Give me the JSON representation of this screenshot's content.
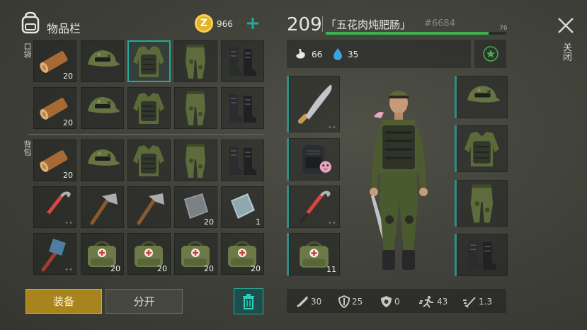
{
  "inventory": {
    "title": "物品栏",
    "coins": "966",
    "pocket_label": "口袋",
    "backpack_label": "背包",
    "pocket_rows": [
      [
        {
          "icon": "log-icon",
          "count": "20"
        },
        {
          "icon": "camo-cap-icon",
          "count": ""
        },
        {
          "icon": "camo-vest-icon",
          "count": "",
          "selected": true
        },
        {
          "icon": "camo-pants-icon",
          "count": ""
        },
        {
          "icon": "boots-icon",
          "count": ""
        }
      ],
      [
        {
          "icon": "log-icon",
          "count": "20"
        },
        {
          "icon": "camo-cap-icon",
          "count": ""
        },
        {
          "icon": "camo-vest-icon",
          "count": ""
        },
        {
          "icon": "camo-pants-icon",
          "count": ""
        },
        {
          "icon": "boots-icon",
          "count": ""
        }
      ]
    ],
    "backpack_rows": [
      [
        {
          "icon": "log-icon",
          "count": "20"
        },
        {
          "icon": "camo-cap-icon",
          "count": ""
        },
        {
          "icon": "camo-vest-icon",
          "count": ""
        },
        {
          "icon": "camo-pants-icon",
          "count": ""
        },
        {
          "icon": "boots-icon",
          "count": ""
        }
      ],
      [
        {
          "icon": "crowbar-icon",
          "count": "",
          "dots": true
        },
        {
          "icon": "hatchet-icon",
          "count": ""
        },
        {
          "icon": "hatchet-icon",
          "count": ""
        },
        {
          "icon": "metal-plate-icon",
          "count": "20"
        },
        {
          "icon": "metal-plate-blue-icon",
          "count": "1"
        }
      ],
      [
        {
          "icon": "sledgehammer-icon",
          "count": "",
          "dots": true
        },
        {
          "icon": "first-aid-bag-icon",
          "count": "20"
        },
        {
          "icon": "first-aid-bag-icon",
          "count": "20"
        },
        {
          "icon": "first-aid-bag-icon",
          "count": "20"
        },
        {
          "icon": "first-aid-bag-icon",
          "count": "20"
        }
      ]
    ],
    "equip_button": "装备",
    "split_button": "分开"
  },
  "player": {
    "level": "209",
    "name": "「五花肉炖肥肠」",
    "id": "#6684",
    "xp_value": "76",
    "xp_fraction": 0.9,
    "hunger": "66",
    "thirst": "35"
  },
  "left_equipment": [
    {
      "icon": "machete-icon",
      "count": "",
      "dots": true
    },
    {
      "icon": "backpack-icon",
      "count": ""
    },
    {
      "icon": "crowbar-icon",
      "count": "",
      "dots": true
    },
    {
      "icon": "first-aid-bag-icon",
      "count": "11"
    }
  ],
  "right_equipment": [
    {
      "icon": "camo-cap-icon"
    },
    {
      "icon": "camo-vest-icon"
    },
    {
      "icon": "camo-pants-icon"
    },
    {
      "icon": "boots-icon"
    }
  ],
  "stats": {
    "attack": "30",
    "defense": "25",
    "radiation": "0",
    "speed": "43",
    "weapon_speed": "1.3"
  },
  "close_label": "关闭",
  "colors": {
    "accent": "#2aa79b",
    "xp_bar": "#3fb04f",
    "equip_button_bg": "#a8841c",
    "coin": "#e2b32a"
  }
}
